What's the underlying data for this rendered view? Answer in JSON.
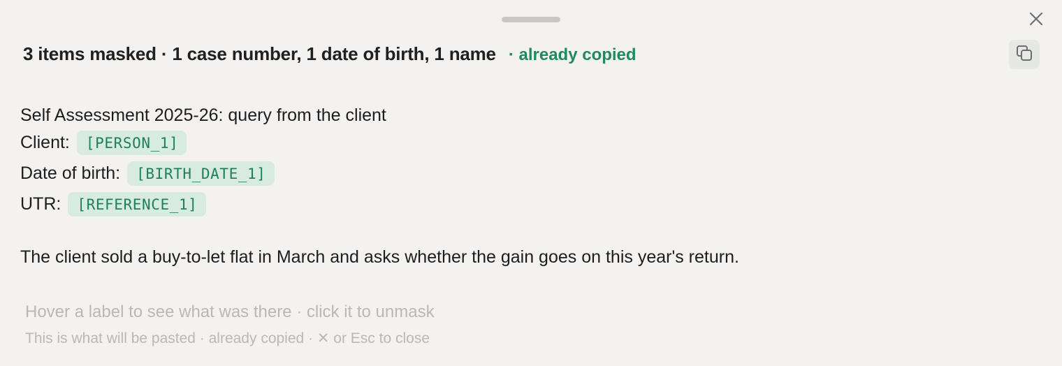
{
  "header": {
    "summary": "3 items masked · 1 case number, 1 date of birth, 1 name",
    "status": "· already copied",
    "close_icon": "close-icon",
    "copy_icon": "copy-icon"
  },
  "content": {
    "heading": "Self Assessment 2025-26: query from the client",
    "fields": [
      {
        "label": "Client:",
        "token": "[PERSON_1]"
      },
      {
        "label": "Date of birth:",
        "token": "[BIRTH_DATE_1]"
      },
      {
        "label": "UTR:",
        "token": "[REFERENCE_1]"
      }
    ],
    "body": "The client sold a buy-to-let flat in March and asks whether the gain goes on this year's return."
  },
  "footer": {
    "hint_primary": "Hover a label to see what was there · click it to unmask",
    "hint_secondary": "This is what will be pasted · already copied · ✕ or Esc to close"
  },
  "colors": {
    "accent_green": "#1f8a5d",
    "chip_background": "#d8ebe3",
    "panel_background": "#f3f2f1"
  }
}
